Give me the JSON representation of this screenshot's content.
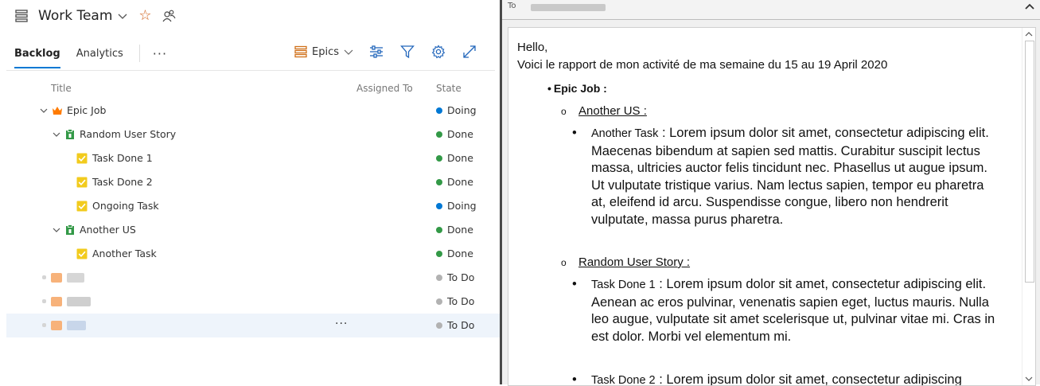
{
  "header": {
    "title": "Work Team"
  },
  "tabs": [
    {
      "label": "Backlog"
    },
    {
      "label": "Analytics"
    }
  ],
  "toolbar": {
    "level_label": "Epics"
  },
  "columns": {
    "title": "Title",
    "assigned_to": "Assigned To",
    "state": "State"
  },
  "rows": [
    {
      "title": "Epic Job",
      "state": "Doing"
    },
    {
      "title": "Random User Story",
      "state": "Done"
    },
    {
      "title": "Task Done 1",
      "state": "Done"
    },
    {
      "title": "Task Done 2",
      "state": "Done"
    },
    {
      "title": "Ongoing Task",
      "state": "Doing"
    },
    {
      "title": "Another US",
      "state": "Done"
    },
    {
      "title": "Another Task",
      "state": "Done"
    },
    {
      "title": "",
      "state": "To Do"
    },
    {
      "title": "",
      "state": "To Do"
    },
    {
      "title": "",
      "state": "To Do"
    }
  ],
  "colors": {
    "doing": "#0078d4",
    "done": "#339947",
    "todo": "#b2b2b2",
    "accent": "#0078d4",
    "epic": "#ff7b00",
    "story": "#009ccc",
    "task": "#f2cb1d"
  },
  "email": {
    "to_label": "To",
    "greeting": "Hello,",
    "intro": "Voici le rapport de mon activité de ma semaine du 15 au 19 April 2020",
    "epic": "Epic Job :",
    "sections": [
      {
        "title": "Another US :",
        "tasks": [
          {
            "name": "Another Task",
            "text": " : Lorem ipsum dolor sit amet, consectetur adipiscing elit. Maecenas bibendum at sapien sed mattis. Curabitur suscipit lectus massa, ultricies auctor felis tincidunt nec. Phasellus ut augue ipsum. Ut vulputate tristique varius. Nam lectus sapien, tempor eu pharetra at, eleifend id arcu. Suspendisse congue, libero non hendrerit vulputate, massa purus pharetra."
          }
        ]
      },
      {
        "title": "Random User Story :",
        "tasks": [
          {
            "name": "Task Done 1",
            "text": " : Lorem ipsum dolor sit amet, consectetur adipiscing elit. Aenean ac eros pulvinar, venenatis sapien eget, luctus mauris. Nulla leo augue, vulputate sit amet scelerisque ut, pulvinar vitae mi. Cras in est dolor. Morbi vel elementum mi."
          },
          {
            "name": "Task Done 2",
            "text": " : Lorem ipsum dolor sit amet, consectetur adipiscing"
          }
        ]
      }
    ]
  }
}
